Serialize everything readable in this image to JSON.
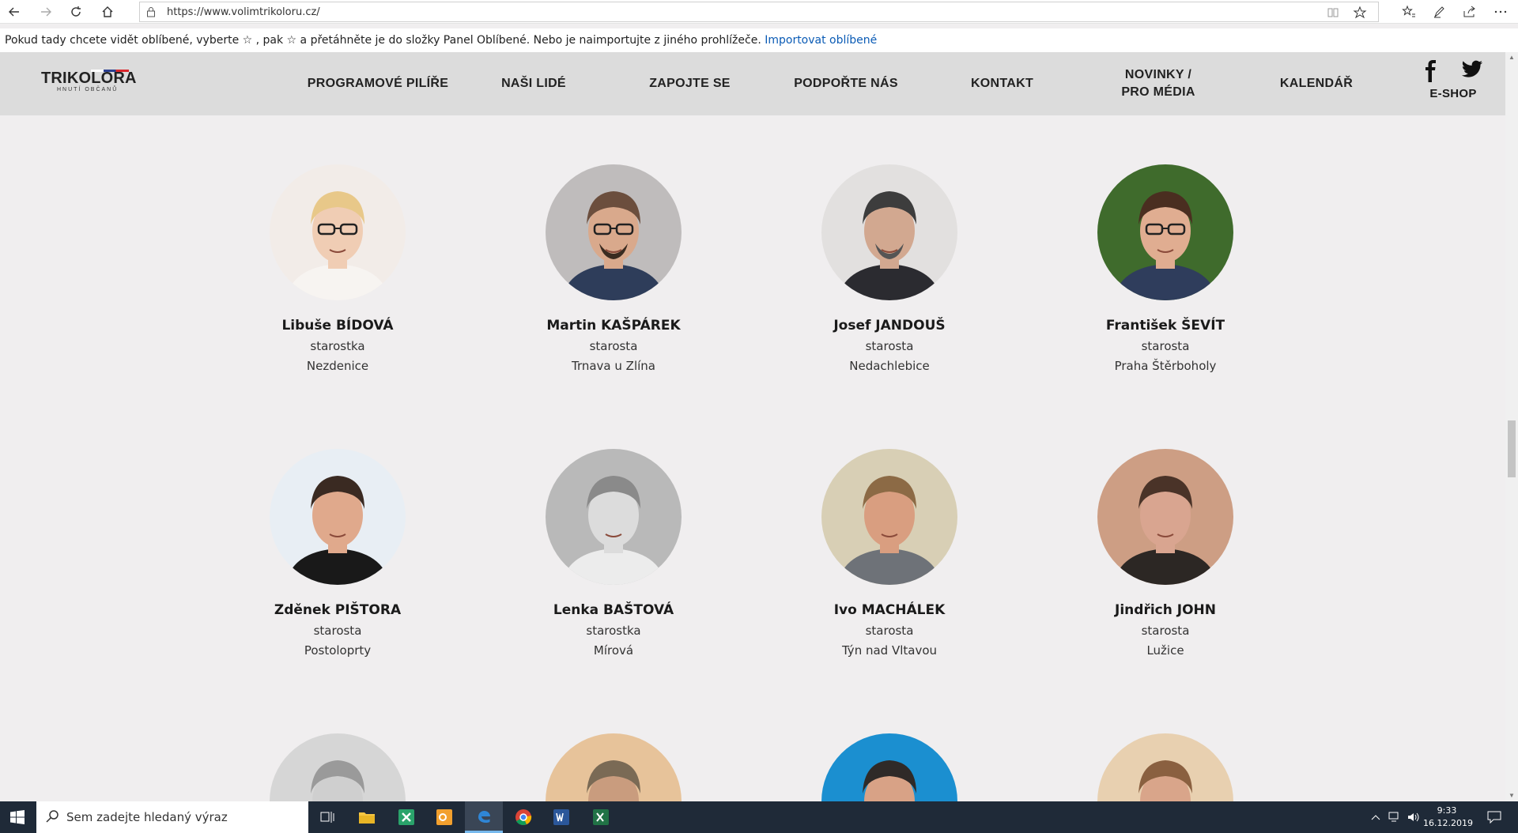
{
  "browser": {
    "url": "https://www.volimtrikoloru.cz/",
    "favbar_message": "Pokud tady chcete vidět oblíbené, vyberte  ☆ , pak ☆ a přetáhněte je do složky Panel Oblíbené. Nebo je naimportujte z jiného prohlížeče.",
    "favbar_link": "Importovat oblíbené"
  },
  "site": {
    "logo_title": "TRIKOLORA",
    "logo_subtitle": "HNUTÍ OBČANŮ",
    "nav": [
      {
        "label": "PROGRAMOVÉ PILÍŘE"
      },
      {
        "label": "NAŠI LIDÉ"
      },
      {
        "label": "ZAPOJTE SE"
      },
      {
        "label": "PODPOŘTE NÁS"
      },
      {
        "label": "KONTAKT"
      },
      {
        "label": "NOVINKY /"
      },
      {
        "label": "PRO MÉDIA"
      },
      {
        "label": "KALENDÁŘ"
      }
    ],
    "eshop_label": "E-SHOP"
  },
  "people": [
    {
      "first": "Libuše",
      "last": "BÍDOVÁ",
      "role": "starostka",
      "place": "Nezdenice"
    },
    {
      "first": "Martin",
      "last": "KAŠPÁREK",
      "role": "starosta",
      "place": "Trnava u Zlína"
    },
    {
      "first": "Josef",
      "last": "JANDOUŠ",
      "role": "starosta",
      "place": "Nedachlebice"
    },
    {
      "first": "František",
      "last": "ŠEVÍT",
      "role": "starosta",
      "place": "Praha Štěrboholy"
    },
    {
      "first": "Zděnek",
      "last": "PIŠTORA",
      "role": "starosta",
      "place": "Postoloprty"
    },
    {
      "first": "Lenka",
      "last": "BAŠTOVÁ",
      "role": "starostka",
      "place": "Mírová"
    },
    {
      "first": "Ivo",
      "last": "MACHÁLEK",
      "role": "starosta",
      "place": "Týn nad Vltavou"
    },
    {
      "first": "Jindřich",
      "last": "JOHN",
      "role": "starosta",
      "place": "Lužice"
    }
  ],
  "people_display": [
    {
      "name": "Libuše BÍDOVÁ"
    },
    {
      "name": "Martin KAŠPÁREK"
    },
    {
      "name": "Josef JANDOUŠ"
    },
    {
      "name": "František ŠEVÍT"
    },
    {
      "name": "Zděnek PIŠTORA"
    },
    {
      "name": "Lenka BAŠTOVÁ"
    },
    {
      "name": "Ivo MACHÁLEK"
    },
    {
      "name": "Jindřich JOHN"
    }
  ],
  "taskbar": {
    "search_placeholder": "Sem zadejte hledaný výraz",
    "time": "9:33",
    "date": "16.12.2019"
  }
}
